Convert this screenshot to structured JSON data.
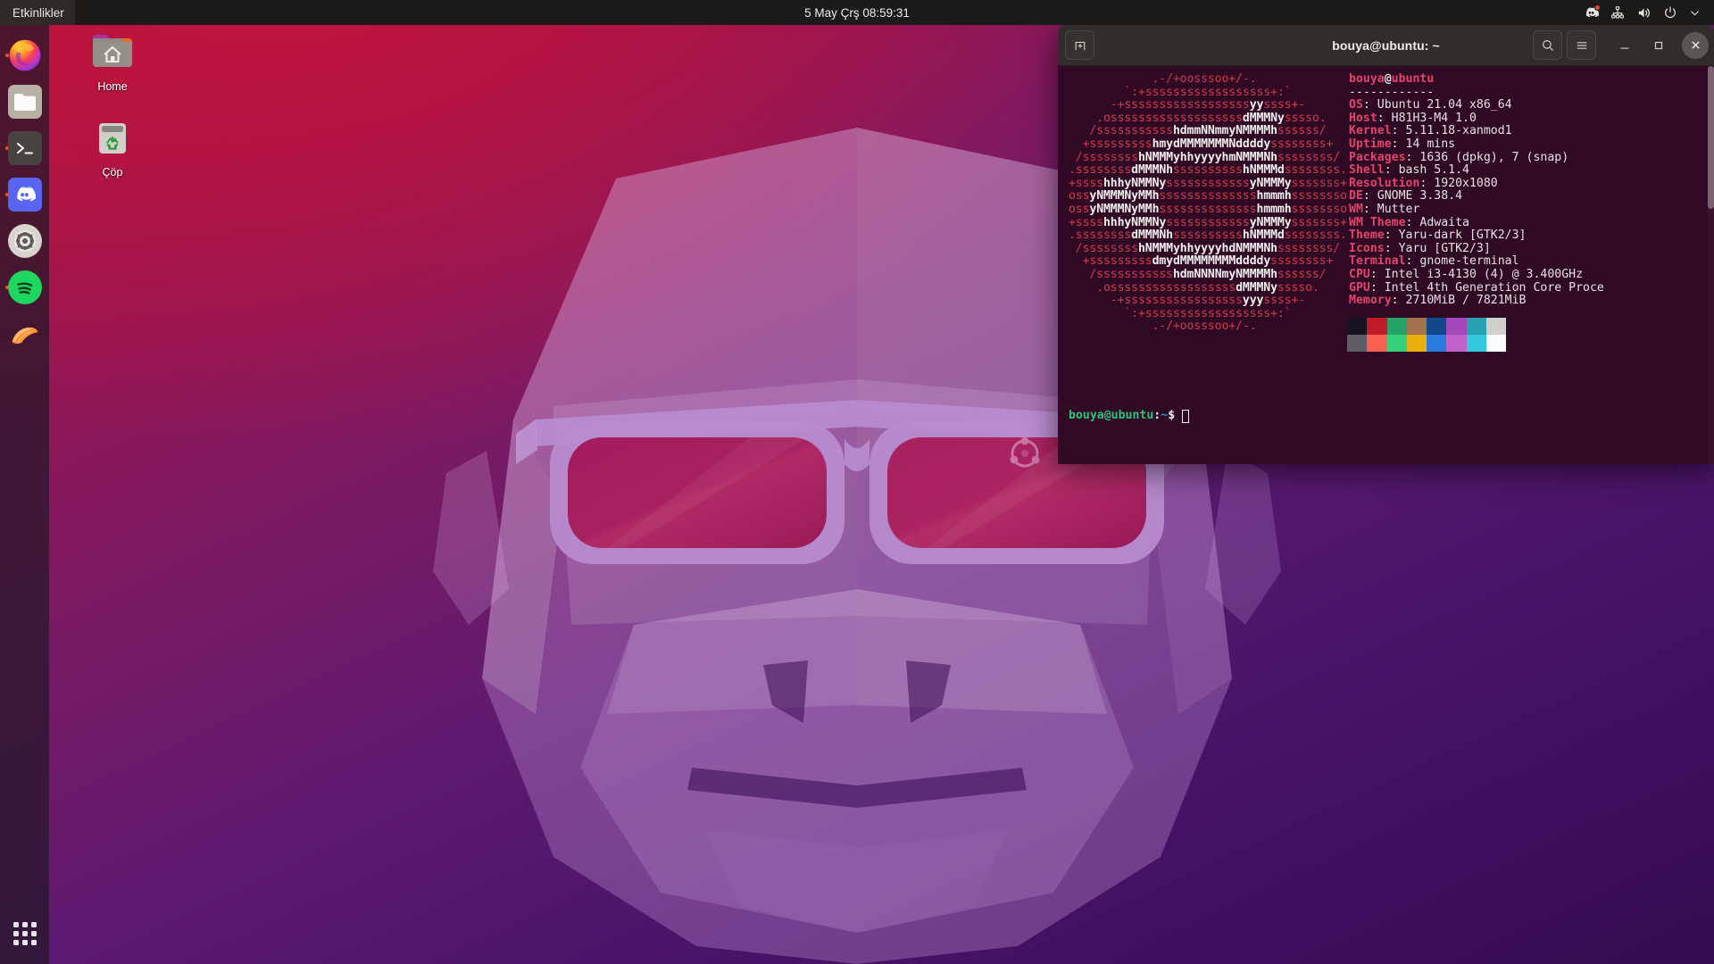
{
  "desktop": {
    "environment": "GNOME",
    "wallpaper_name": "ubuntu-hirsute-hippo-gorilla",
    "colors": {
      "panel_bg": "#1d1b1a",
      "dock_bg": "#231728",
      "accent_orange": "#e95420",
      "terminal_bg": "#300a24",
      "titlebar_bg": "#302d2b",
      "wallpaper_red": "#b8143c",
      "wallpaper_purple": "#340c50"
    }
  },
  "top_panel": {
    "activities_label": "Etkinlikler",
    "clock": "5 May Çrş  08:59:31",
    "tray": [
      {
        "name": "discord-icon",
        "label": "Discord",
        "has_badge": true
      },
      {
        "name": "network-icon",
        "label": "Ağ"
      },
      {
        "name": "volume-icon",
        "label": "Ses"
      },
      {
        "name": "power-icon",
        "label": "Güç"
      },
      {
        "name": "chevron-down-icon",
        "label": "Menü"
      }
    ]
  },
  "dock": {
    "items": [
      {
        "name": "dock-item-firefox",
        "label": "Firefox",
        "running": true
      },
      {
        "name": "dock-item-files",
        "label": "Dosyalar",
        "running": false
      },
      {
        "name": "dock-item-terminal",
        "label": "Terminal",
        "running": true
      },
      {
        "name": "dock-item-discord",
        "label": "Discord",
        "running": true
      },
      {
        "name": "dock-item-settings",
        "label": "Ayarlar",
        "running": false
      },
      {
        "name": "dock-item-spotify",
        "label": "Spotify",
        "running": true
      },
      {
        "name": "dock-item-ubuntu-software",
        "label": "Ubuntu Software",
        "running": false
      }
    ],
    "apps_button_label": "Uygulamaları Göster"
  },
  "desktop_icons": [
    {
      "name": "desktop-icon-home",
      "label": "Home",
      "icon": "home-folder-icon"
    },
    {
      "name": "desktop-icon-trash",
      "label": "Çöp",
      "icon": "trash-icon"
    }
  ],
  "terminal": {
    "title": "bouya@ubuntu: ~",
    "titlebar_buttons": {
      "new_tab": "new-tab-icon",
      "search": "search-icon",
      "menu": "hamburger-menu-icon",
      "minimize": "minimize-icon",
      "maximize": "maximize-icon",
      "close": "close-icon"
    },
    "prompt": {
      "user_host": "bouya@ubuntu",
      "colon": ":",
      "path": "~",
      "dollar": "$"
    },
    "neofetch": {
      "user_at_host": {
        "user": "bouya",
        "at": "@",
        "host": "ubuntu"
      },
      "divider": "------------",
      "entries": [
        {
          "key": "OS",
          "value": "Ubuntu 21.04 x86_64"
        },
        {
          "key": "Host",
          "value": "H81H3-M4 1.0"
        },
        {
          "key": "Kernel",
          "value": "5.11.18-xanmod1"
        },
        {
          "key": "Uptime",
          "value": "14 mins"
        },
        {
          "key": "Packages",
          "value": "1636 (dpkg), 7 (snap)"
        },
        {
          "key": "Shell",
          "value": "bash 5.1.4"
        },
        {
          "key": "Resolution",
          "value": "1920x1080"
        },
        {
          "key": "DE",
          "value": "GNOME 3.38.4"
        },
        {
          "key": "WM",
          "value": "Mutter"
        },
        {
          "key": "WM Theme",
          "value": "Adwaita"
        },
        {
          "key": "Theme",
          "value": "Yaru-dark [GTK2/3]"
        },
        {
          "key": "Icons",
          "value": "Yaru [GTK2/3]"
        },
        {
          "key": "Terminal",
          "value": "gnome-terminal"
        },
        {
          "key": "CPU",
          "value": "Intel i3-4130 (4) @ 3.400GHz"
        },
        {
          "key": "GPU",
          "value": "Intel 4th Generation Core Proce"
        },
        {
          "key": "Memory",
          "value": "2710MiB / 7821MiB"
        }
      ],
      "ascii_art": [
        "            .-/+oosssoo+/-.",
        "        `:+ssssssssssssssssss+:`",
        "      -+ssssssssssssssssssyyssss+-",
        "    .osssssssssssssssssssdMMMNysssso.",
        "   /ssssssssssshdmmNNmmyNMMMMhssssss/",
        "  +ssssssssshmydMMMMMMMNddddyssssssss+",
        " /sssssssshNMMMyhhyyyyhmNMMMNhssssssss/",
        ".ssssssssdMMMNhsssssssssshNMMMdssssssss.",
        "+sssshhhyNMMNyssssssssssssyNMMMysssssss+",
        "ossyNMMMNyMMhsssssssssssssshmmmhssssssso",
        "ossyNMMMNyMMhsssssssssssssshmmmhssssssso",
        "+sssshhhyNMMNyssssssssssssyNMMMysssssss+",
        ".ssssssssdMMMNhsssssssssshNMMMdssssssss.",
        " /sssssssshNMMMyhhyyyyhdNMMMNhssssssss/",
        "  +sssssssssdmydMMMMMMMMddddyssssssss+",
        "   /ssssssssssshdmNNNNmyNMMMMhssssss/",
        "    .ossssssssssssssssssdMMMNysssso.",
        "      -+sssssssssssssssssyyyssss+-",
        "        `:+ssssssssssssssssss+:`",
        "            .-/+oosssoo+/-."
      ],
      "palette": {
        "row1": [
          "#171421",
          "#c01c28",
          "#26a269",
          "#a2734c",
          "#12488b",
          "#a347ba",
          "#2aa1b3",
          "#d0cfcc"
        ],
        "row2": [
          "#5e5c64",
          "#f66151",
          "#33d17a",
          "#e9ad0c",
          "#2a7bde",
          "#c061cb",
          "#33c7de",
          "#ffffff"
        ]
      }
    }
  }
}
